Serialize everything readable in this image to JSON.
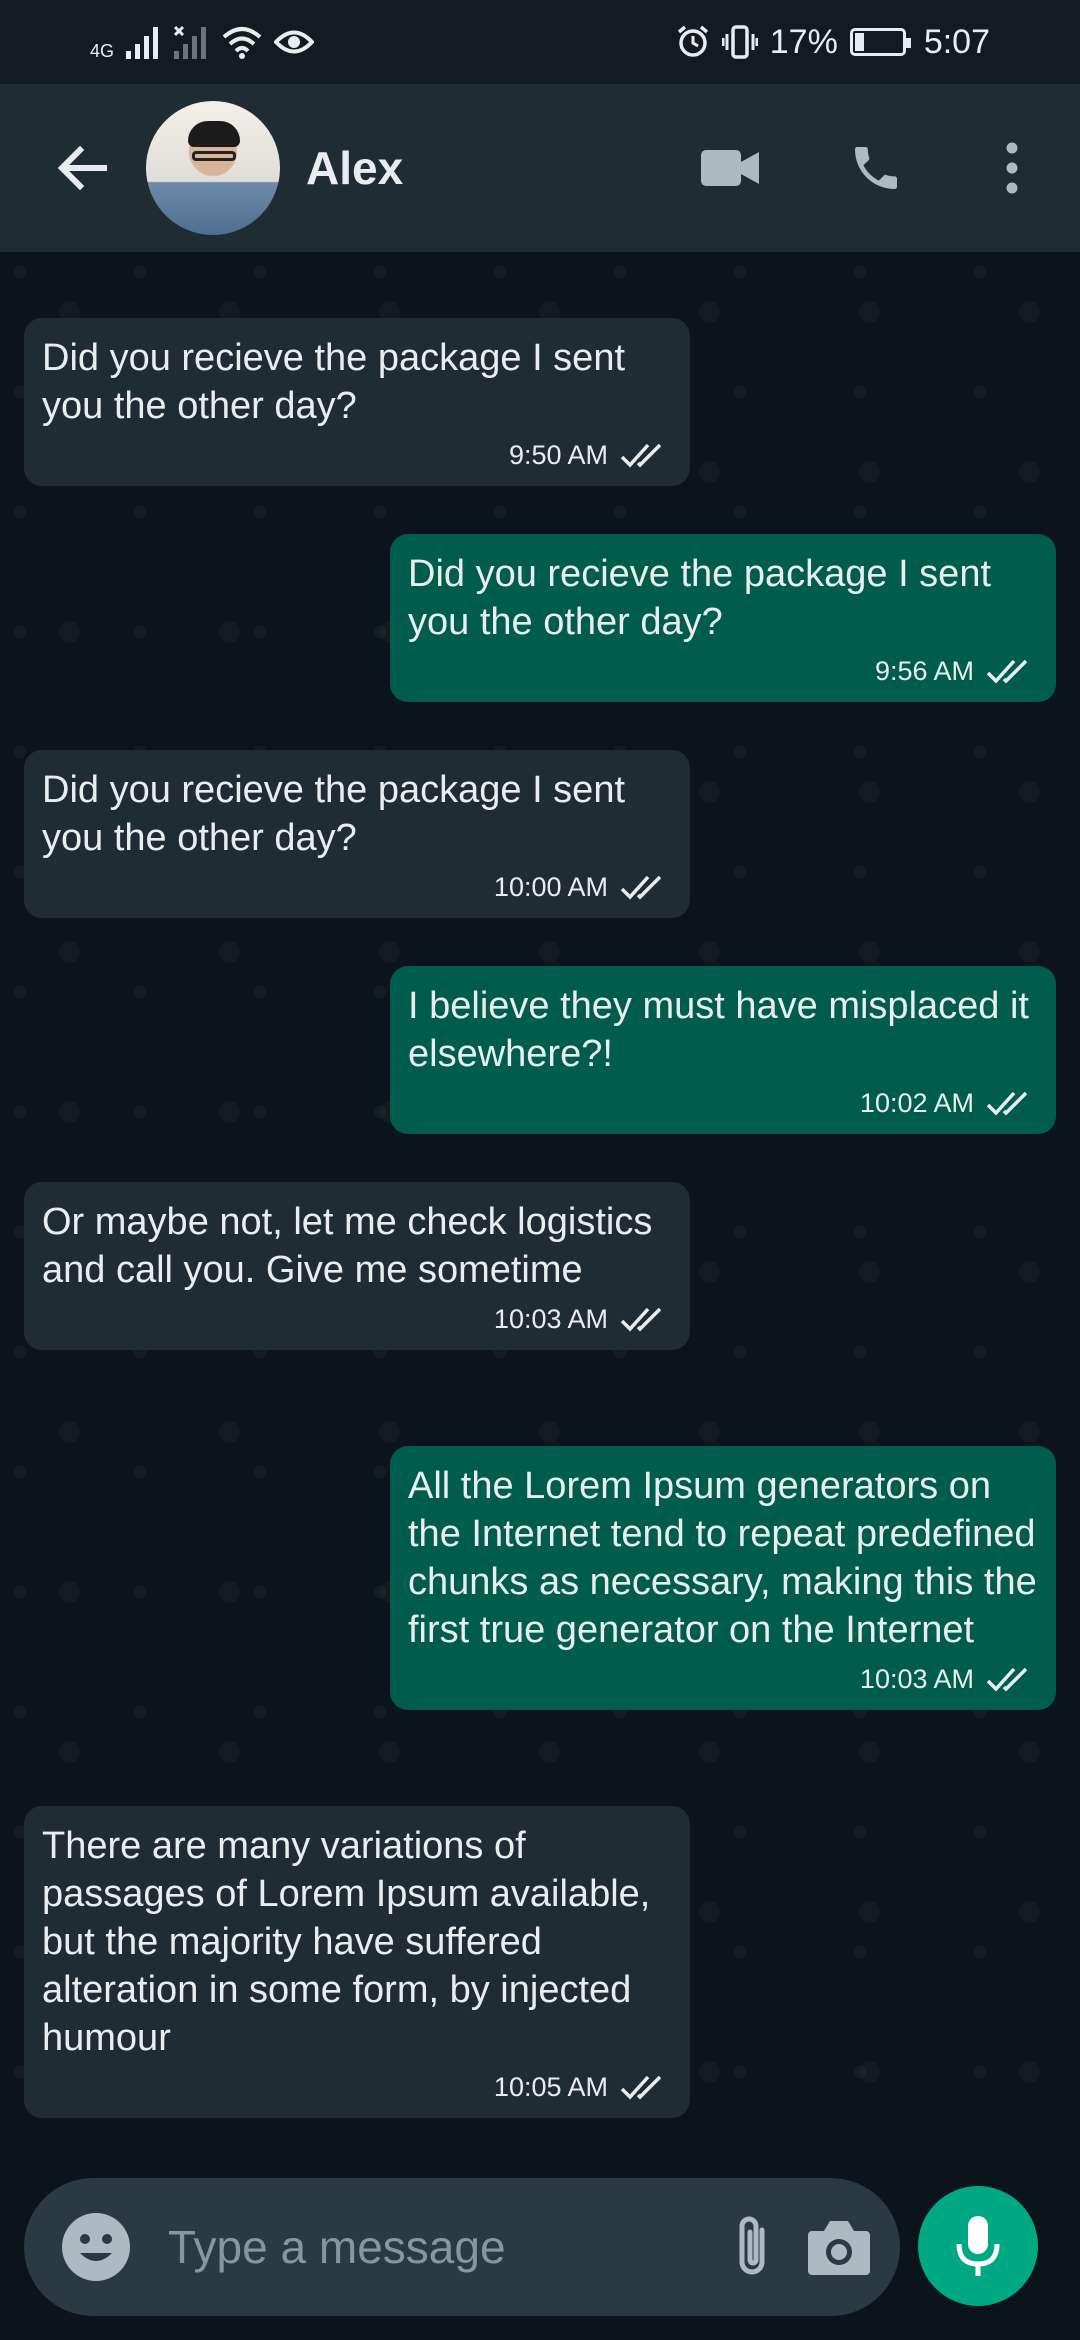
{
  "status_bar": {
    "network_label": "4G",
    "battery_percent": "17%",
    "time": "5:07"
  },
  "header": {
    "contact_name": "Alex",
    "icons": [
      "back-arrow-icon",
      "avatar",
      "video-call-icon",
      "phone-icon",
      "more-vert-icon"
    ]
  },
  "messages": [
    {
      "direction": "in",
      "text": "Did you recieve the package I sent you the other day?",
      "time": "9:50 AM"
    },
    {
      "direction": "out",
      "text": "Did you recieve the package I sent you the other day?",
      "time": "9:56 AM"
    },
    {
      "direction": "in",
      "text": "Did you recieve the package I sent you the other day?",
      "time": "10:00 AM"
    },
    {
      "direction": "out",
      "text": "I believe they must have misplaced it elsewhere?!",
      "time": "10:02 AM"
    },
    {
      "direction": "in",
      "text": "Or maybe not, let me check logistics and call you. Give me sometime",
      "time": "10:03 AM"
    },
    {
      "direction": "out",
      "text": "All the Lorem Ipsum generators on the Internet tend to repeat predefined chunks as necessary, making this the first true generator on the Internet",
      "time": "10:03 AM"
    },
    {
      "direction": "in",
      "text": "There are many variations of passages of Lorem Ipsum available, but the majority have suffered alteration in some form, by injected humour",
      "time": "10:05 AM"
    }
  ],
  "composer": {
    "placeholder": "Type a message",
    "icons": [
      "emoji-icon",
      "attach-icon",
      "camera-icon",
      "mic-icon"
    ]
  },
  "colors": {
    "incoming_bubble": "#202c33",
    "outgoing_bubble": "#005c4b",
    "accent": "#00a884",
    "background": "#0b141a"
  }
}
